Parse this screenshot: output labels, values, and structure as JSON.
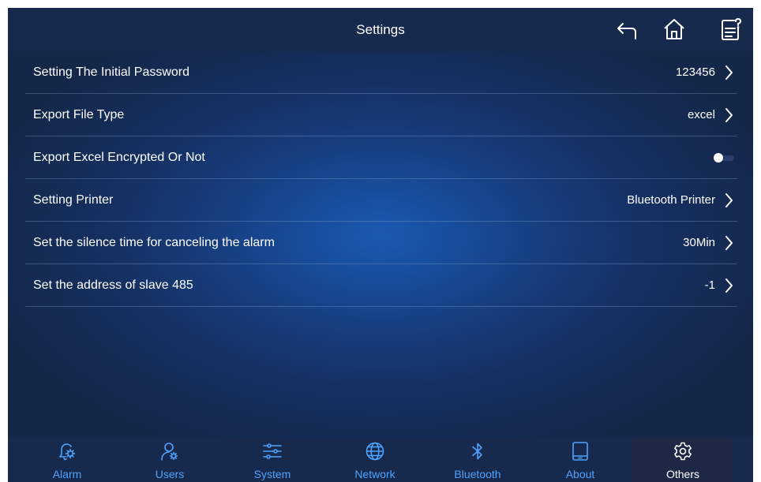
{
  "header": {
    "title": "Settings"
  },
  "icons": {
    "back": "back-arrow-icon",
    "home": "home-icon",
    "help": "help-document-icon"
  },
  "settings": [
    {
      "label": "Setting The Initial Password",
      "value": "123456",
      "control": "chevron"
    },
    {
      "label": "Export File Type",
      "value": "excel",
      "control": "chevron"
    },
    {
      "label": "Export Excel Encrypted Or Not",
      "value": "",
      "control": "toggle",
      "toggle_on": false
    },
    {
      "label": "Setting Printer",
      "value": "Bluetooth Printer",
      "control": "chevron"
    },
    {
      "label": "Set the silence time for canceling the alarm",
      "value": "30Min",
      "control": "chevron"
    },
    {
      "label": "Set the address of slave 485",
      "value": "-1",
      "control": "chevron"
    }
  ],
  "tabs": [
    {
      "label": "Alarm",
      "icon": "alarm-bell-gear-icon",
      "active": false
    },
    {
      "label": "Users",
      "icon": "user-gear-icon",
      "active": false
    },
    {
      "label": "System",
      "icon": "sliders-icon",
      "active": false
    },
    {
      "label": "Network",
      "icon": "globe-icon",
      "active": false
    },
    {
      "label": "Bluetooth",
      "icon": "bluetooth-icon",
      "active": false
    },
    {
      "label": "About",
      "icon": "tablet-icon",
      "active": false
    },
    {
      "label": "Others",
      "icon": "gear-icon",
      "active": true
    }
  ],
  "colors": {
    "accent": "#4fa3ff",
    "bar_background": "#172a4e",
    "active_tab_background": "#1c2846",
    "text": "#ffffff"
  }
}
